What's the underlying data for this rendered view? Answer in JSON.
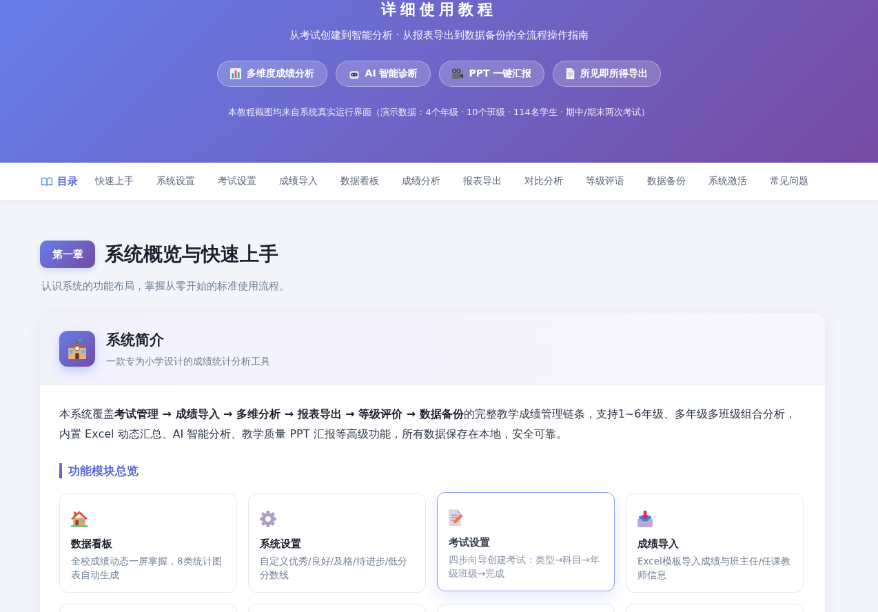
{
  "hero": {
    "title": "详细使用教程",
    "subtitle": "从考试创建到智能分析 · 从报表导出到数据备份的全流程操作指南",
    "features": [
      {
        "label": "多维度成绩分析"
      },
      {
        "label": "AI 智能诊断"
      },
      {
        "label": "PPT 一键汇报"
      },
      {
        "label": "所见即所得导出"
      }
    ],
    "note": "本教程截图均来自系统真实运行界面（演示数据：4个年级 · 10个班级 · 114名学生 · 期中/期末两次考试）"
  },
  "toc": {
    "label": "目录",
    "items": [
      "快速上手",
      "系统设置",
      "考试设置",
      "成绩导入",
      "数据看板",
      "成绩分析",
      "报表导出",
      "对比分析",
      "等级评语",
      "数据备份",
      "系统激活",
      "常见问题"
    ]
  },
  "chapter": {
    "badge": "第一章",
    "title": "系统概览与快速上手",
    "subtitle": "认识系统的功能布局，掌握从零开始的标准使用流程。"
  },
  "card": {
    "title": "系统简介",
    "subtitle": "一款专为小学设计的成绩统计分析工具",
    "intro": "本系统覆盖**考试管理 → 成绩导入 → 多维分析 → 报表导出 → 等级评价 → 数据备份**的完整教学成绩管理链条，支持1~6年级、多年级多班级组合分析，内置 Excel 动态汇总、AI 智能分析、教学质量 PPT 汇报等高级功能，所有数据保存在本地，安全可靠。",
    "section_title": "功能模块总览",
    "modules": [
      {
        "title": "数据看板",
        "description": "全校成绩动态一屏掌握，8类统计图表自动生成",
        "highlighted": false
      },
      {
        "title": "系统设置",
        "description": "自定义优秀/良好/及格/待进步/低分分数线",
        "highlighted": false
      },
      {
        "title": "考试设置",
        "description": "四步向导创建考试：类型→科目→年级班级→完成",
        "highlighted": true
      },
      {
        "title": "成绩导入",
        "description": "Excel模板导入成绩与班主任/任课教师信息",
        "highlighted": false
      }
    ]
  }
}
